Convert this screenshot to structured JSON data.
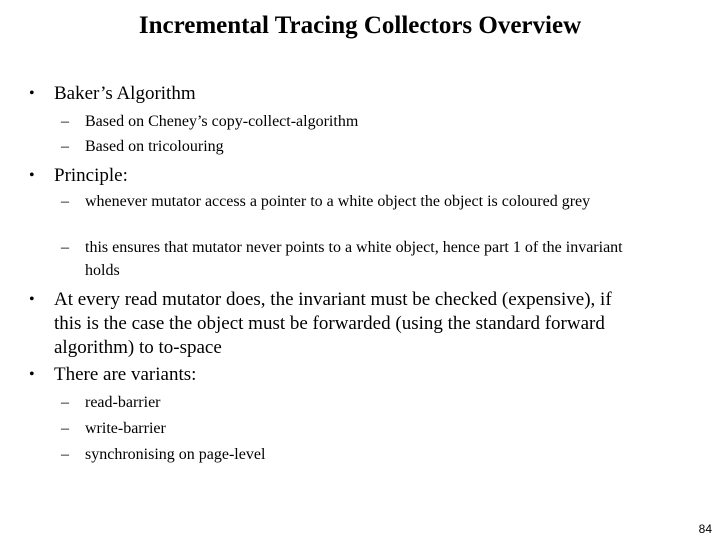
{
  "slide": {
    "title": "Incremental Tracing Collectors Overview",
    "page_number": "84",
    "bullet_symbol": "•",
    "dash_symbol": "–",
    "items": [
      {
        "text": "Baker’s Algorithm",
        "subitems": [
          "Based on Cheney’s copy-collect-algorithm",
          "Based on tricolouring"
        ]
      },
      {
        "text": "Principle:",
        "subitems": [
          "whenever mutator access a pointer to a white object the object is coloured grey",
          "this ensures that mutator never points to a white object, hence part 1 of the invariant holds"
        ]
      },
      {
        "text": "At every read mutator does, the invariant must be checked (expensive), if this is the case the object must be forwarded (using the standard forward algorithm) to to-space",
        "subitems": []
      },
      {
        "text": "There are variants:",
        "subitems": [
          "read-barrier",
          "write-barrier",
          "synchronising on page-level"
        ]
      }
    ]
  }
}
